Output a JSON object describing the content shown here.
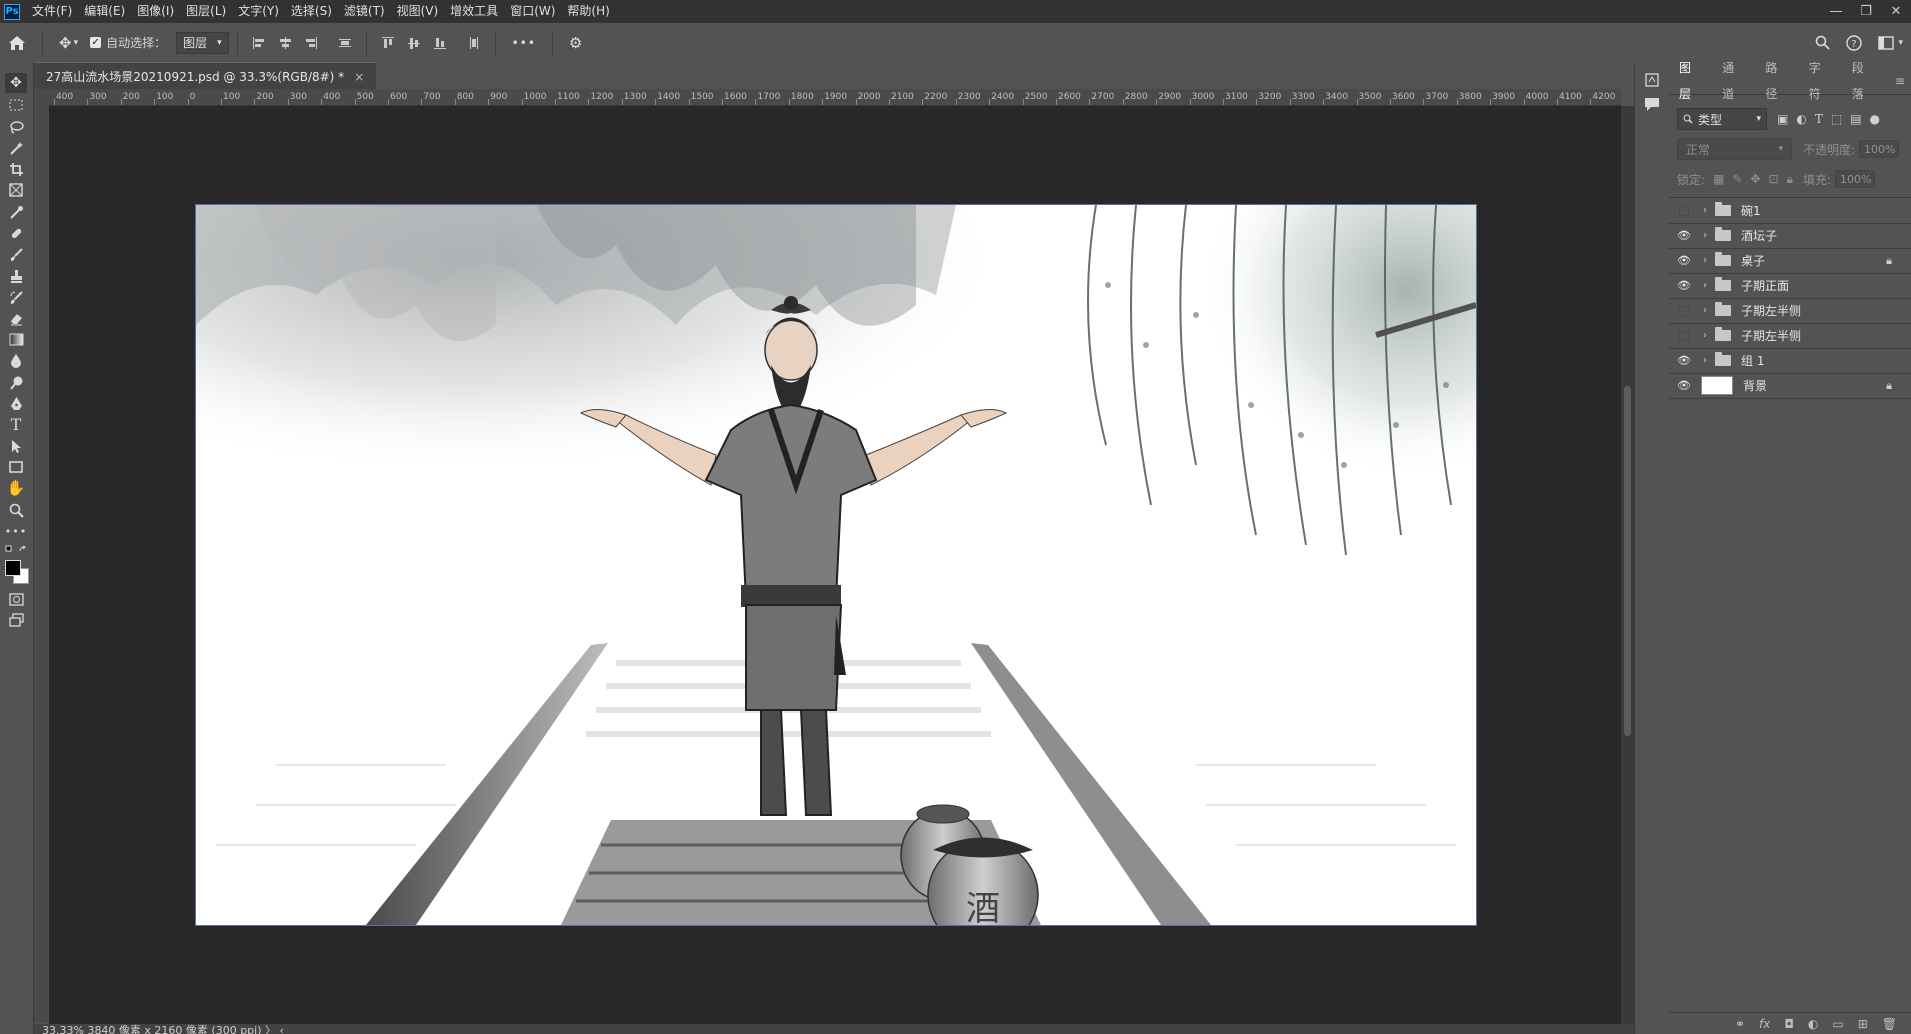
{
  "app": {
    "logo": "Ps",
    "menu": [
      "文件(F)",
      "编辑(E)",
      "图像(I)",
      "图层(L)",
      "文字(Y)",
      "选择(S)",
      "滤镜(T)",
      "视图(V)",
      "增效工具",
      "窗口(W)",
      "帮助(H)"
    ],
    "window_controls": [
      "—",
      "❐",
      "✕"
    ]
  },
  "options_bar": {
    "auto_select_label": "自动选择：",
    "auto_select_checked": true,
    "target_select": "图层",
    "more": "•••"
  },
  "document": {
    "tab_title": "27高山流水场景20210921.psd @ 33.3%(RGB/8#) *",
    "close": "×",
    "ruler_ticks": [
      "400",
      "300",
      "200",
      "100",
      "0",
      "100",
      "200",
      "300",
      "400",
      "500",
      "600",
      "700",
      "800",
      "900",
      "1000",
      "1100",
      "1200",
      "1300",
      "1400",
      "1500",
      "1600",
      "1700",
      "1800",
      "1900",
      "2000",
      "2100",
      "2200",
      "2300",
      "2400",
      "2500",
      "2600",
      "2700",
      "2800",
      "2900",
      "3000",
      "3100",
      "3200",
      "3300",
      "3400",
      "3500",
      "3600",
      "3700",
      "3800",
      "3900",
      "4000",
      "4100",
      "4200"
    ],
    "status": "33.33%   3840 像素 x 2160 像素 (300 ppi)   〉   ‹",
    "jar_label": "酒"
  },
  "layers_panel": {
    "tabs": [
      "图层",
      "通道",
      "路径",
      "字符",
      "段落"
    ],
    "active_tab": "图层",
    "filter_label": "类型",
    "blend_mode": "正常",
    "opacity_label": "不透明度:",
    "opacity_value": "100%",
    "lock_label": "锁定:",
    "fill_label": "填充:",
    "fill_value": "100%",
    "layers": [
      {
        "name": "碗1",
        "visible": false,
        "type": "group",
        "locked": false
      },
      {
        "name": "酒坛子",
        "visible": true,
        "type": "group",
        "locked": false
      },
      {
        "name": "桌子",
        "visible": true,
        "type": "group",
        "locked": true
      },
      {
        "name": "子期正面",
        "visible": true,
        "type": "group",
        "locked": false
      },
      {
        "name": "子期左半侧",
        "visible": false,
        "type": "group",
        "locked": false
      },
      {
        "name": "子期左半侧",
        "visible": false,
        "type": "group",
        "locked": false
      },
      {
        "name": "组 1",
        "visible": true,
        "type": "group",
        "locked": false
      },
      {
        "name": "背景",
        "visible": true,
        "type": "background",
        "locked": true
      }
    ]
  },
  "colors": {
    "menubar": "#323232",
    "panel": "#535353",
    "pasteboard": "#282828",
    "accent": "#31a8ff"
  }
}
